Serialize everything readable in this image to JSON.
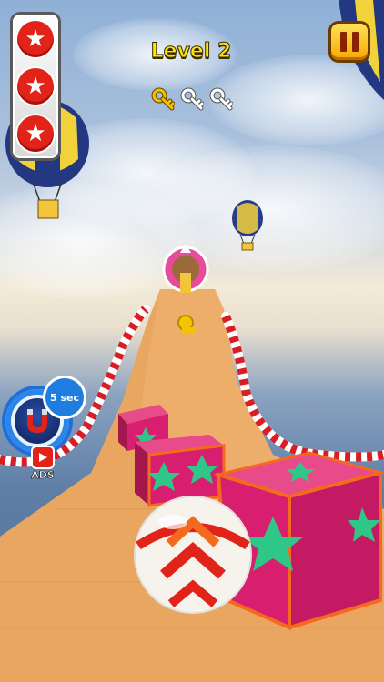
{
  "hud": {
    "level_label": "Level 2",
    "stars_collected": 3,
    "stars_total": 3,
    "keys": [
      {
        "state": "collected",
        "color": "#f5c400"
      },
      {
        "state": "empty",
        "color": "#ffffff"
      },
      {
        "state": "empty",
        "color": "#ffffff"
      }
    ],
    "pause_icon": "pause-icon"
  },
  "powerup": {
    "name": "magnet-icon",
    "timer_label": "5 sec",
    "ads_label": "ADS",
    "ads_icon": "play-video-icon"
  },
  "colors": {
    "star_red": "#e2231a",
    "level_yellow": "#ffe600",
    "crate_pink": "#d81e6e",
    "crate_star": "#2fc788",
    "track_wood": "#e8a660",
    "rail_red": "#d81e24"
  }
}
